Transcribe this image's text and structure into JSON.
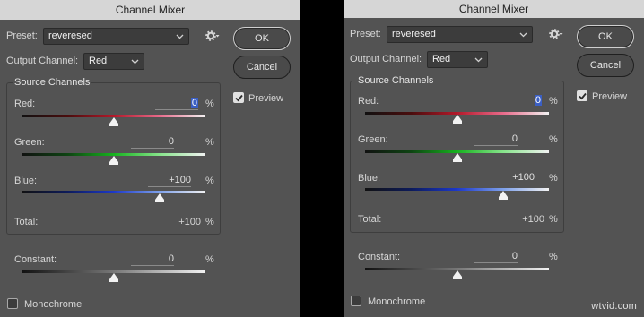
{
  "dialogs": [
    {
      "title": "Channel Mixer",
      "preset_label": "Preset:",
      "preset_value": "reveresed",
      "output_channel_label": "Output Channel:",
      "output_channel_value": "Red",
      "ok_label": "OK",
      "cancel_label": "Cancel",
      "preview_label": "Preview",
      "preview_checked": true,
      "source_channels_label": "Source Channels",
      "channels": [
        {
          "label": "Red:",
          "value": "0",
          "unit": "%",
          "level": 0.5,
          "selected": true
        },
        {
          "label": "Green:",
          "value": "0",
          "unit": "%",
          "level": 0.5,
          "selected": false
        },
        {
          "label": "Blue:",
          "value": "+100",
          "unit": "%",
          "level": 0.75,
          "selected": false
        }
      ],
      "total_label": "Total:",
      "total_value": "+100",
      "total_unit": "%",
      "constant_label": "Constant:",
      "constant_value": "0",
      "constant_unit": "%",
      "constant_level": 0.5,
      "monochrome_label": "Monochrome",
      "monochrome_checked": false
    },
    {
      "title": "Channel Mixer",
      "preset_label": "Preset:",
      "preset_value": "reveresed",
      "output_channel_label": "Output Channel:",
      "output_channel_value": "Red",
      "ok_label": "OK",
      "cancel_label": "Cancel",
      "preview_label": "Preview",
      "preview_checked": true,
      "source_channels_label": "Source Channels",
      "channels": [
        {
          "label": "Red:",
          "value": "0",
          "unit": "%",
          "level": 0.5,
          "selected": true
        },
        {
          "label": "Green:",
          "value": "0",
          "unit": "%",
          "level": 0.5,
          "selected": false
        },
        {
          "label": "Blue:",
          "value": "+100",
          "unit": "%",
          "level": 0.75,
          "selected": false
        }
      ],
      "total_label": "Total:",
      "total_value": "+100",
      "total_unit": "%",
      "constant_label": "Constant:",
      "constant_value": "0",
      "constant_unit": "%",
      "constant_level": 0.5,
      "monochrome_label": "Monochrome",
      "monochrome_checked": false
    }
  ],
  "watermark": "wtvid.com",
  "icons": {
    "gear": "gear-icon",
    "chevron": "chevron-down-icon",
    "check": "checkmark-icon"
  },
  "colors": {
    "dialog_bg": "#535353",
    "title_bar": "#d6d6d6",
    "separator": "#000000",
    "selection": "#3b5fc4"
  }
}
